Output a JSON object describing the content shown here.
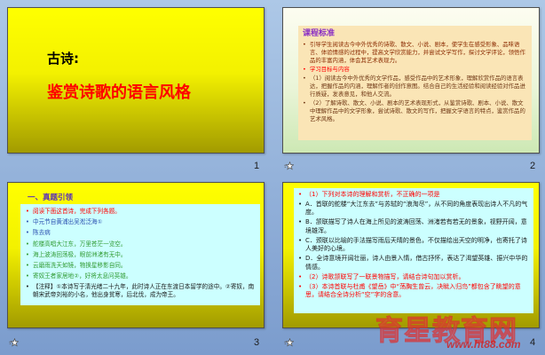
{
  "colors": {
    "page_background_top": "#adc8e7",
    "page_background_bottom": "#7b9ccd",
    "slide_yellow": "#ffff00",
    "slide_olive": "#a29b00",
    "text_red": "#ff0000",
    "heading_purple": "#8a2fc4",
    "poem_green": "#2f9a2f",
    "content_cyan": "#ccffff",
    "content_peach": "#fae5b6"
  },
  "slides": [
    {
      "number": "1",
      "title": "古诗:",
      "subtitle": "鉴赏诗歌的语言风格"
    },
    {
      "number": "2",
      "transition_icon": "star-icon",
      "heading": "课程标准",
      "bullets": [
        "引导学生阅读古今中外优秀的诗歌、散文、小说、剧本，使学生在感受形象、品味语言、体验情感的过程中，提高文学欣赏能力，并尝试文学写作，探讨文学评论，领悟作品的丰富内涵，体会其艺术表现力。",
        "学习目标与内容",
        "（1）阅读古今中外优秀的文学作品，感受作品中的艺术形象，理解欣赏作品的语言表达，把握作品的内涵，理解作者的创作意图。结合自己的生活经验和阅读经验对作品进行质疑，发表意见，和他人交流。",
        "（2）了解诗歌、散文、小说、剧本的艺术表现形式，从鉴赏诗歌、剧本、小说、散文中理解作品中的文学形象，尝试诗歌、散文的写作，把握文学语言的特点，鉴赏作品的艺术风格。"
      ]
    },
    {
      "number": "3",
      "transition_icon": "star-icon",
      "heading": "一、真题引领",
      "bullets": [
        "阅读下面这首诗，完成下列各题。",
        "中元节自黄浦出吴淞泛海①",
        "陈去病",
        "舵楼高唱大江东，万里苍茫一览空。",
        "海上波涛回荡极，眼前洲渚有无中。",
        "云磨雨洗天如镜，物换星移影自同。",
        "寄奴王者家居地②，好将太息问英雄。",
        "【注释】①本诗写于清光绪二十九年，此时诗人正在东渡日本留学的途中。②寄奴，南朝宋武帝刘裕的小名，他出身贫寒，后北伐，成为帝王。"
      ]
    },
    {
      "number": "4",
      "transition_icon": "star-icon",
      "bullets": [
        "（1）下列对本诗的理解和赏析，不正确的一项是",
        "A．首联的舵楼“大江东去”与苏轼的“浪淘尽”，从不同的角度表现出诗人不凡的气度。",
        "B．颔联描写了诗人在海上所见的波涛回荡、洲渚若有若无的景象，视野开阔，意境雄浑。",
        "C．颈联以比喻的手法描写雨后天晴的景色，不仅描绘出天空的明净，也寄托了诗人美好的心境。",
        "D．全诗意境开阔壮丽，诗人由景入情，借古抒怀，表达了渴望英雄、振兴中华的情感。",
        "（2）诗歌颔联写了一联景物描写，请结合诗句加以赏析。",
        "（3）本诗首联与杜甫《望岳》中“荡胸生曾云，决眦入归鸟”都包含了眺望的意思，请结合全诗分析“空”字的含意。"
      ]
    }
  ],
  "watermark": {
    "site_name": "育星教育网",
    "url": "www.ht88.com"
  }
}
